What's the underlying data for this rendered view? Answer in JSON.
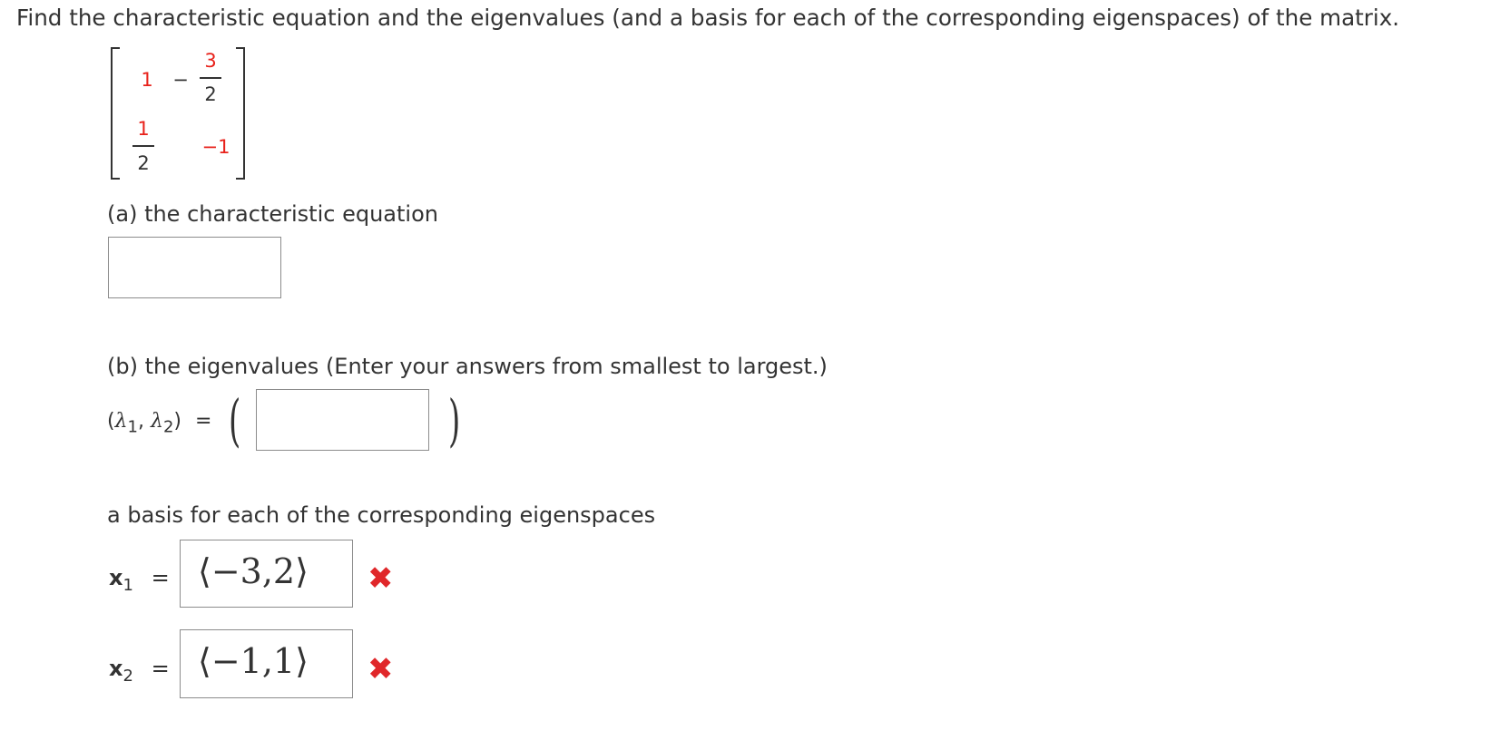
{
  "question": "Find the characteristic equation and the eigenvalues (and a basis for each of the corresponding eigenspaces) of the matrix.",
  "matrix": {
    "r1c1": "1",
    "r1c2_sign": "−",
    "r1c2_num": "3",
    "r1c2_den": "2",
    "r2c1_num": "1",
    "r2c1_den": "2",
    "r2c2": "−1"
  },
  "part_a": {
    "label": "(a) the characteristic equation",
    "answer": ""
  },
  "part_b": {
    "label": "(b) the eigenvalues (Enter your answers from smallest to largest.)",
    "lhs_open": "(",
    "lambda": "λ",
    "sub1": "1",
    "comma": ",",
    "sub2": "2",
    "lhs_close": ")",
    "equals": "=",
    "answer": ""
  },
  "part_c": {
    "label": "a basis for each of the corresponding eigenspaces",
    "rows": [
      {
        "var": "x",
        "sub": "1",
        "equals": "=",
        "value": "⟨−3,2⟩",
        "status_icon": "incorrect-x-icon",
        "status_glyph": "✖"
      },
      {
        "var": "x",
        "sub": "2",
        "equals": "=",
        "value": "⟨−1,1⟩",
        "status_icon": "incorrect-x-icon",
        "status_glyph": "✖"
      }
    ]
  },
  "colors": {
    "text": "#333333",
    "highlight": "#e8211a",
    "incorrect": "#e0272a",
    "box_border": "#8c8c8c"
  }
}
